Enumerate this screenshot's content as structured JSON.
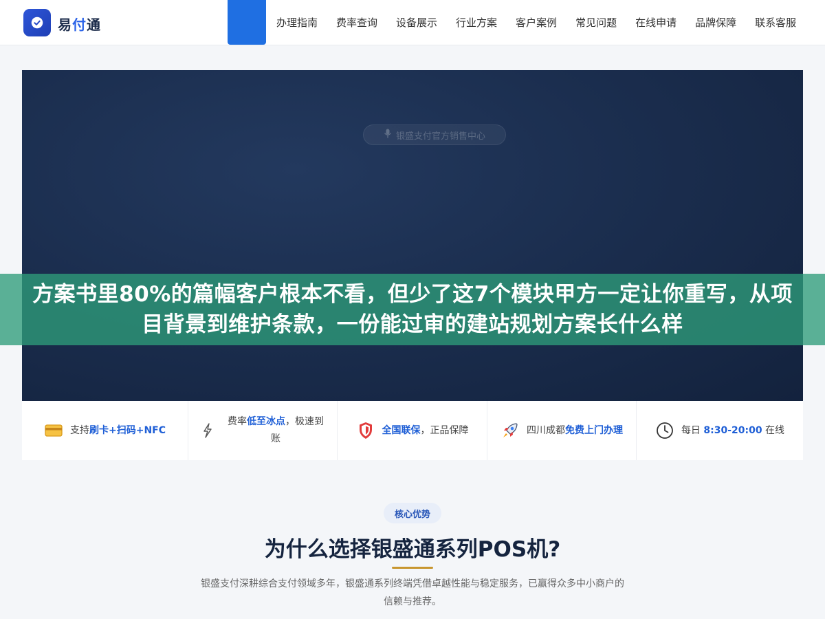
{
  "header": {
    "logo_text_a": "易",
    "logo_text_b": "付",
    "logo_text_c": "通",
    "nav": [
      "办理指南",
      "费率查询",
      "设备展示",
      "行业方案",
      "客户案例",
      "常见问题",
      "在线申请",
      "品牌保障",
      "联系客服"
    ]
  },
  "hero": {
    "tag": "银盛支付官方销售中心",
    "title": "方案书里80%的篇幅客户根本不看，但少了这7个模块甲方一定让你重写，从项目背景到维护条款，一份能过审的建站规划方案长什么样"
  },
  "features": [
    {
      "icon": "card-icon",
      "pre": "支持",
      "hl": "刷卡+扫码+NFC",
      "post": ""
    },
    {
      "icon": "lightning-icon",
      "pre": "费率",
      "hl": "低至冰点",
      "post": "，极速到账"
    },
    {
      "icon": "shield-icon",
      "pre": "",
      "hl": "全国联保",
      "post": "，正品保障"
    },
    {
      "icon": "rocket-icon",
      "pre": "四川成都",
      "hl": "免费上门办理",
      "post": ""
    },
    {
      "icon": "clock-icon",
      "pre": "每日 ",
      "hl": "8:30-20:00",
      "post": " 在线"
    }
  ],
  "section": {
    "badge": "核心优势",
    "title": "为什么选择银盛通系列POS机?",
    "desc": "银盛支付深耕综合支付领域多年，银盛通系列终端凭借卓越性能与稳定服务，已赢得众多中小商户的信赖与推荐。"
  },
  "colors": {
    "accent": "#1f6fe2",
    "highlight": "#1f5fd6",
    "band": "#2e9c7a",
    "gold": "#c8962f"
  }
}
